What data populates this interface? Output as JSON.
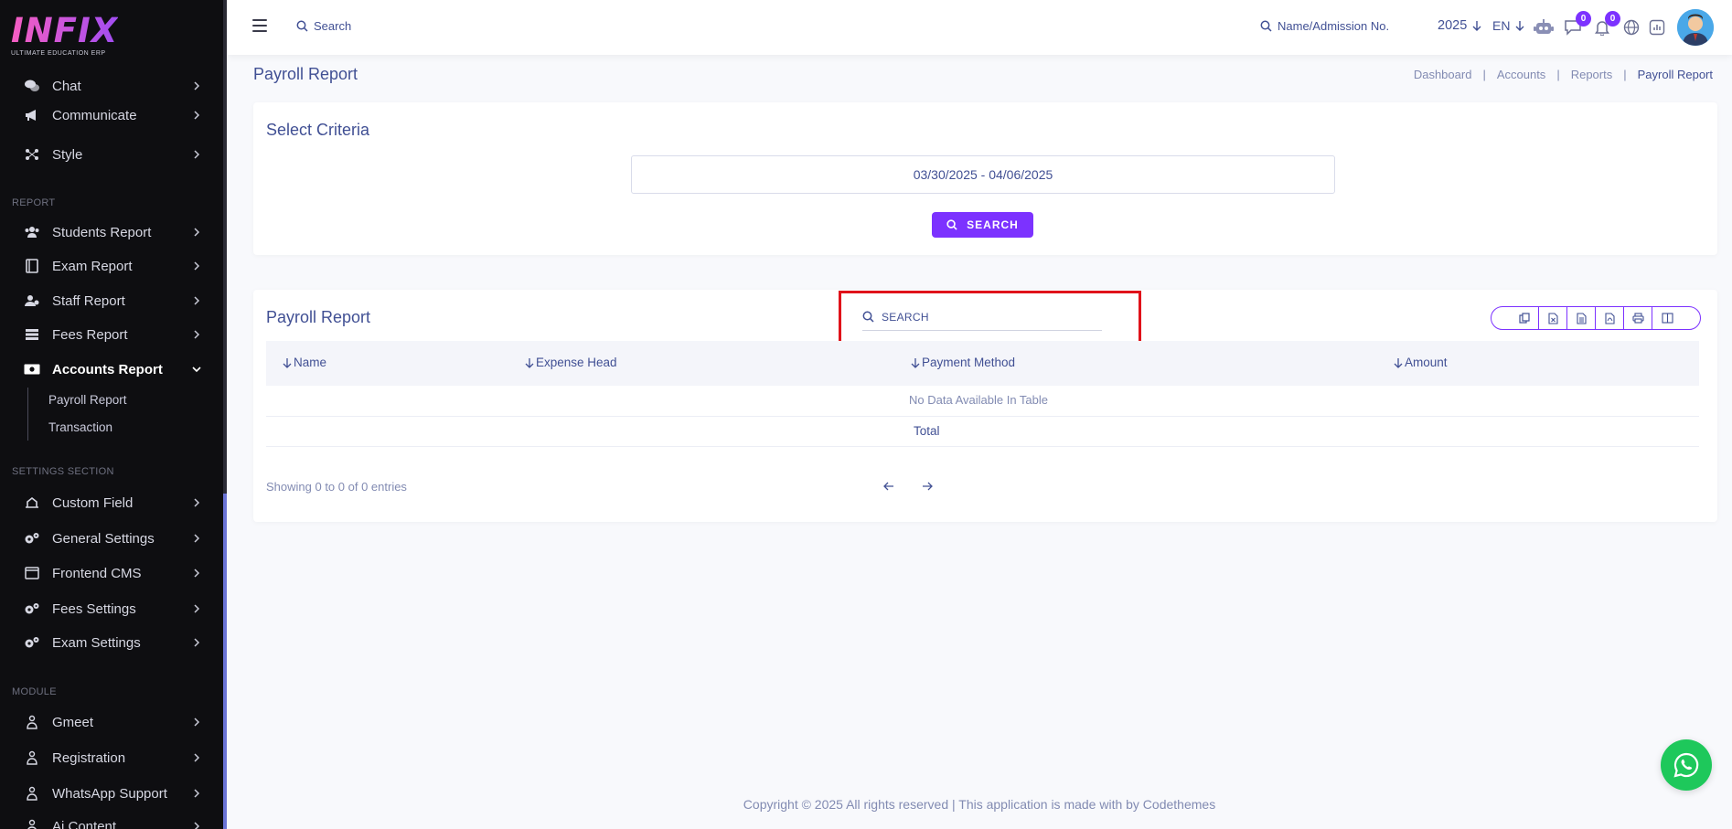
{
  "brand": {
    "logo_text": "INFIX",
    "tagline": "ULTIMATE EDUCATION ERP"
  },
  "sidebar": {
    "items_top": [
      {
        "label": "Chat",
        "icon": "chat-icon"
      },
      {
        "label": "Communicate",
        "icon": "megaphone-icon"
      },
      {
        "label": "Style",
        "icon": "style-icon"
      }
    ],
    "section_report": "REPORT",
    "report_items": [
      {
        "label": "Students Report",
        "icon": "users-icon"
      },
      {
        "label": "Exam Report",
        "icon": "book-icon"
      },
      {
        "label": "Staff Report",
        "icon": "staff-icon"
      },
      {
        "label": "Fees Report",
        "icon": "list-icon"
      },
      {
        "label": "Accounts Report",
        "icon": "money-icon"
      }
    ],
    "accounts_sub": [
      "Payroll Report",
      "Transaction"
    ],
    "section_settings": "SETTINGS SECTION",
    "settings_items": [
      {
        "label": "Custom Field",
        "icon": "field-icon"
      },
      {
        "label": "General Settings",
        "icon": "gears-icon"
      },
      {
        "label": "Frontend CMS",
        "icon": "cms-icon"
      },
      {
        "label": "Fees Settings",
        "icon": "gears-icon"
      },
      {
        "label": "Exam Settings",
        "icon": "gears-icon"
      }
    ],
    "section_module": "MODULE",
    "module_items": [
      {
        "label": "Gmeet",
        "icon": "module-icon"
      },
      {
        "label": "Registration",
        "icon": "module-icon"
      },
      {
        "label": "WhatsApp Support",
        "icon": "module-icon"
      },
      {
        "label": "Ai Content",
        "icon": "module-icon"
      }
    ]
  },
  "topbar": {
    "search_placeholder": "Search",
    "name_search_placeholder": "Name/Admission No.",
    "year": "2025",
    "language": "EN",
    "messages_count": "0",
    "notifications_count": "0"
  },
  "page": {
    "title": "Payroll Report",
    "breadcrumb": [
      "Dashboard",
      "Accounts",
      "Reports",
      "Payroll Report"
    ]
  },
  "criteria": {
    "title": "Select Criteria",
    "date_range": "03/30/2025 - 04/06/2025",
    "search_button": "SEARCH"
  },
  "report": {
    "title": "Payroll Report",
    "table_search_placeholder": "SEARCH",
    "columns": [
      "Name",
      "Expense Head",
      "Payment Method",
      "Amount"
    ],
    "empty_message": "No Data Available In Table",
    "total_label": "Total",
    "showing": "Showing 0 to 0 of 0 entries",
    "export_buttons": [
      "copy-icon",
      "excel-icon",
      "csv-icon",
      "pdf-icon",
      "print-icon",
      "columns-icon"
    ]
  },
  "footer": {
    "text": "Copyright © 2025 All rights reserved | This application is made with by Codethemes"
  },
  "colors": {
    "accent": "#7c32ff",
    "text": "#415094",
    "sidebar_bg": "#0e0e11",
    "highlight": "#e0121a",
    "whatsapp": "#1ec85b"
  }
}
